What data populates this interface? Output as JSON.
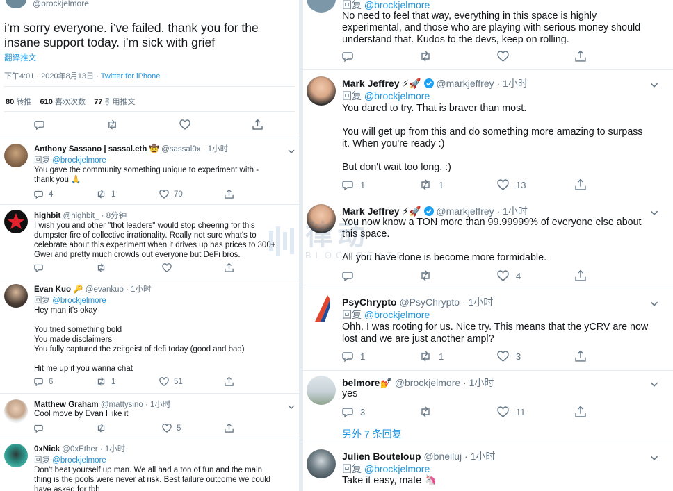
{
  "main_tweet": {
    "handle": "@brockjelmore",
    "text": "i’m sorry everyone. i’ve failed. thank you for the\ninsane support today. i’m sick with grief",
    "translate": "翻译推文",
    "time": "下午4:01 · 2020年8月13日 · ",
    "source": "Twitter for iPhone",
    "stats": {
      "retweets_n": "80",
      "retweets_l": "转推",
      "likes_n": "610",
      "likes_l": "喜欢次数",
      "quotes_n": "77",
      "quotes_l": "引用推文"
    }
  },
  "reply_prefix": "回复",
  "left_replies": [
    {
      "name": "Anthony Sassano | sassal.eth 🤠",
      "handle": "@sassal0x · 1小时",
      "reply_to": "@brockjelmore",
      "text": "You gave the community something unique to experiment with -\nthank you 🙏",
      "replies": "4",
      "retweets": "1",
      "likes": "70"
    },
    {
      "name": "highbit",
      "handle": "@highbit_ · 8分钟",
      "text": "I wish you and other \"thot leaders\" would stop cheering for this\ndumpster fire of collective irrationality. Really not sure what's to\ncelebrate about this experiment when it drives up has prices to 300+\nGwei and pretty much crowds out everyone but DeFi bros."
    },
    {
      "name": "Evan Kuo 🔑",
      "handle": "@evankuo · 1小时",
      "reply_to": "@brockjelmore",
      "text": "Hey man it's okay\n\nYou tried something bold\nYou made disclaimers\nYou fully captured the zeitgeist of defi today (good and bad)\n\nHit me up if you wanna chat",
      "replies": "6",
      "retweets": "1",
      "likes": "51"
    },
    {
      "name": "Matthew Graham",
      "handle": "@mattysino · 1小时",
      "text": "Cool move by Evan I like it",
      "likes": "5"
    },
    {
      "name": "0xNick",
      "handle": "@0xEther · 1小时",
      "reply_to": "@brockjelmore",
      "text": "Don't beat yourself up man. We all had a ton of fun and the main\nthing is the pools were never at risk. Best failure outcome we could\nhave asked for tbh"
    }
  ],
  "right_replies": [
    {
      "reply_to": "@brockjelmore",
      "text": "No need to feel that way, everything in this space is highly\nexperimental, and those who are playing with serious money should\nunderstand that. Kudos to the devs, keep on rolling."
    },
    {
      "name": "Mark Jeffrey ⚡🚀",
      "handle": "@markjeffrey · 1小时",
      "reply_to": "@brockjelmore",
      "text": "You dared to try. That is braver than most.\n\nYou will get up from this and do something more amazing to surpass\nit.  When you're ready :)\n\nBut don't wait too long. :)",
      "replies": "1",
      "retweets": "1",
      "likes": "13"
    },
    {
      "name": "Mark Jeffrey ⚡🚀",
      "handle": "@markjeffrey · 1小时",
      "text": "You now know a TON more than 99.99999% of everyone else about\nthis space.\n\nAll you have done is become more formidable.",
      "likes": "4"
    },
    {
      "name": "PsyChrypto",
      "handle": "@PsyChrypto · 1小时",
      "reply_to": "@brockjelmore",
      "text": "Ohh. I was rooting for us. Nice try. This means that the yCRV are now\nlost and we are just another ampl?",
      "replies": "1",
      "retweets": "1",
      "likes": "3"
    },
    {
      "name": "belmore💅",
      "handle": "@brockjelmore · 1小时",
      "text": "yes",
      "replies": "3",
      "likes": "11"
    },
    {
      "more": "另外 7 条回复"
    },
    {
      "name": "Julien Bouteloup",
      "handle": "@bneiluj · 1小时",
      "reply_to": "@brockjelmore",
      "text": "Take it easy, mate 🦄"
    }
  ],
  "watermark": {
    "line1": "律动",
    "line2": "BLOCKBEATS"
  },
  "colors": {
    "link": "#1b95e0",
    "secondary": "#657786",
    "divider": "#e6ecf0",
    "verified": "#1da1f2"
  },
  "icons": [
    "reply-icon",
    "retweet-icon",
    "like-icon",
    "share-icon",
    "chevron-down-icon",
    "verified-icon"
  ]
}
